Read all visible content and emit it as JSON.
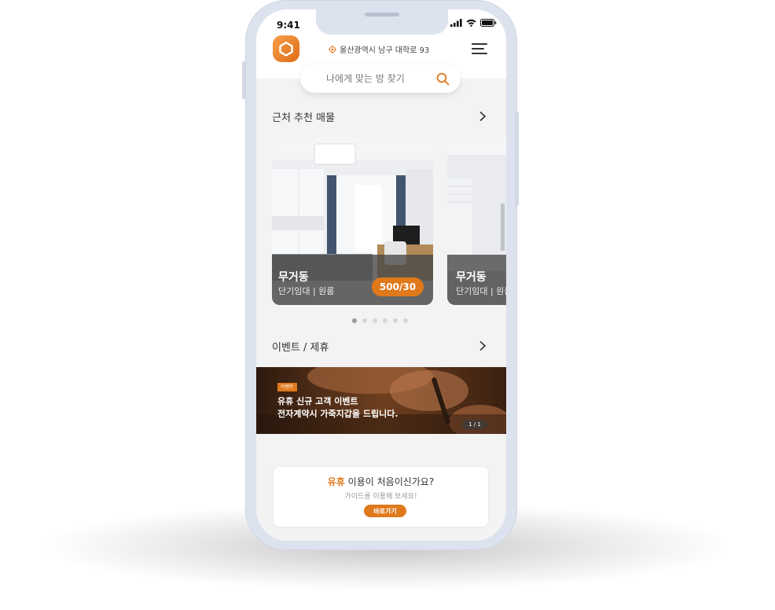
{
  "status_bar": {
    "time": "9:41"
  },
  "header": {
    "address": "울산광역시 남구 대학로 93"
  },
  "search": {
    "placeholder": "나에게 맞는 방 찾기"
  },
  "recommend": {
    "title": "근처 추천 매물",
    "cards": [
      {
        "name": "무거동",
        "type": "단기임대 | 원룸",
        "price": "500/30"
      },
      {
        "name": "무거동",
        "type": "단기임대 | 원룸"
      }
    ],
    "page_count": 6,
    "active_page": 1
  },
  "events": {
    "title": "이벤트 / 제휴",
    "banner": {
      "badge": "이벤트",
      "line1": "유휴 신규 고객 이벤트",
      "line2": "전자계약시 가죽지갑을 드립니다.",
      "pager": "1 / 1"
    }
  },
  "guide": {
    "brand": "유휴",
    "title_rest": " 이용이 처음이신가요?",
    "subtitle": "가이드를 이용해 보세요!",
    "button": "바로가기"
  },
  "colors": {
    "accent": "#e0791c",
    "background": "#f3f3f3"
  }
}
